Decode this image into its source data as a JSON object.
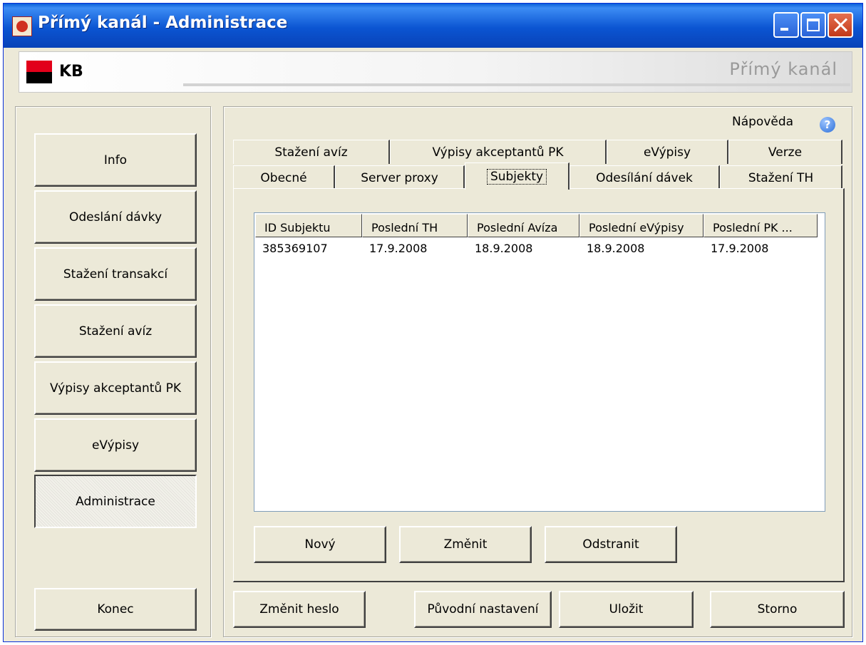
{
  "window": {
    "title": "Přímý kanál - Administrace"
  },
  "banner": {
    "logo_text": "KB",
    "title": "Přímý kanál"
  },
  "sidebar": {
    "items": [
      {
        "label": "Info"
      },
      {
        "label": "Odeslání dávky"
      },
      {
        "label": "Stažení transakcí"
      },
      {
        "label": "Stažení avíz"
      },
      {
        "label": "Výpisy akceptantů PK"
      },
      {
        "label": "eVýpisy"
      },
      {
        "label": "Administrace",
        "active": true
      }
    ],
    "exit_label": "Konec"
  },
  "help": {
    "label": "Nápověda",
    "icon": "help-icon"
  },
  "tabs": {
    "row_back": [
      "Stažení avíz",
      "Výpisy akceptantů PK",
      "eVýpisy",
      "Verze"
    ],
    "row_front": [
      "Obecné",
      "Server proxy",
      "Subjekty",
      "Odesílání dávek",
      "Stažení TH"
    ],
    "active": "Subjekty"
  },
  "table": {
    "columns": [
      "ID Subjektu",
      "Poslední TH",
      "Poslední Avíza",
      "Poslední eVýpisy",
      "Poslední PK ..."
    ],
    "rows": [
      [
        "385369107",
        "17.9.2008",
        "18.9.2008",
        "18.9.2008",
        "17.9.2008"
      ]
    ]
  },
  "actions": {
    "new": "Nový",
    "edit": "Změnit",
    "remove": "Odstranit"
  },
  "footer": {
    "change_password": "Změnit heslo",
    "defaults": "Původní nastavení",
    "save": "Uložit",
    "cancel": "Storno"
  }
}
